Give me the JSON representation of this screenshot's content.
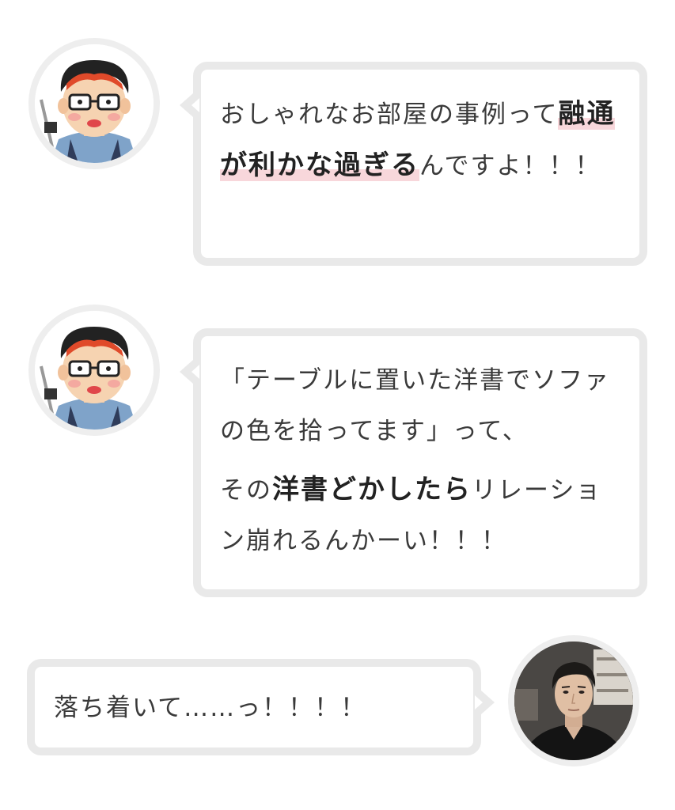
{
  "messages": [
    {
      "speaker": "illustration-man",
      "paragraphs": [
        {
          "segments": [
            {
              "text": "おしゃれなお部屋の事例って"
            },
            {
              "text": "融通が利かな過ぎる",
              "strong": true,
              "highlight": true
            },
            {
              "text": "んですよ！！！"
            }
          ]
        }
      ]
    },
    {
      "speaker": "illustration-man",
      "paragraphs": [
        {
          "segments": [
            {
              "text": "「テーブルに置いた洋書でソファの色を拾ってます」って、"
            }
          ]
        },
        {
          "segments": [
            {
              "text": "その"
            },
            {
              "text": "洋書どかしたら",
              "strong": true
            },
            {
              "text": "リレーション崩れるんかーい！！！"
            }
          ]
        }
      ]
    },
    {
      "speaker": "photo-man",
      "paragraphs": [
        {
          "segments": [
            {
              "text": "落ち着いて……っ！！！！"
            }
          ]
        }
      ]
    }
  ],
  "colors": {
    "bubble_border": "#e9e9e9",
    "highlight": "#f8d7db",
    "text": "#3a3a3a"
  }
}
